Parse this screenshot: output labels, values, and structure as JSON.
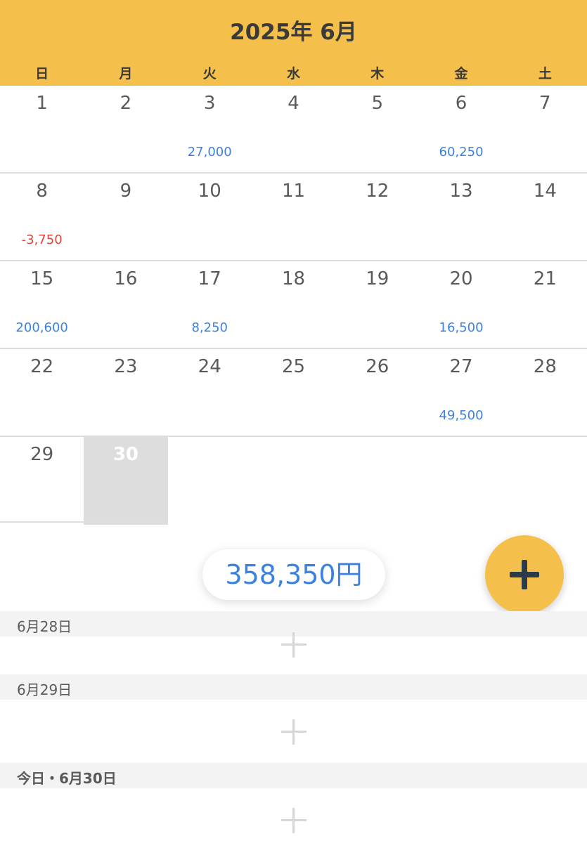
{
  "header": {
    "title": "2025年 6月",
    "weekdays": [
      "日",
      "月",
      "火",
      "水",
      "木",
      "金",
      "土"
    ]
  },
  "calendar": {
    "weeks": [
      [
        {
          "day": "1",
          "amount": ""
        },
        {
          "day": "2",
          "amount": ""
        },
        {
          "day": "3",
          "amount": "27,000"
        },
        {
          "day": "4",
          "amount": ""
        },
        {
          "day": "5",
          "amount": ""
        },
        {
          "day": "6",
          "amount": "60,250"
        },
        {
          "day": "7",
          "amount": ""
        }
      ],
      [
        {
          "day": "8",
          "amount": "-3,750"
        },
        {
          "day": "9",
          "amount": ""
        },
        {
          "day": "10",
          "amount": ""
        },
        {
          "day": "11",
          "amount": ""
        },
        {
          "day": "12",
          "amount": ""
        },
        {
          "day": "13",
          "amount": ""
        },
        {
          "day": "14",
          "amount": ""
        }
      ],
      [
        {
          "day": "15",
          "amount": "200,600"
        },
        {
          "day": "16",
          "amount": ""
        },
        {
          "day": "17",
          "amount": "8,250"
        },
        {
          "day": "18",
          "amount": ""
        },
        {
          "day": "19",
          "amount": ""
        },
        {
          "day": "20",
          "amount": "16,500"
        },
        {
          "day": "21",
          "amount": ""
        }
      ],
      [
        {
          "day": "22",
          "amount": ""
        },
        {
          "day": "23",
          "amount": ""
        },
        {
          "day": "24",
          "amount": ""
        },
        {
          "day": "25",
          "amount": ""
        },
        {
          "day": "26",
          "amount": ""
        },
        {
          "day": "27",
          "amount": "49,500"
        },
        {
          "day": "28",
          "amount": ""
        }
      ],
      [
        {
          "day": "29",
          "amount": ""
        },
        {
          "day": "30",
          "amount": ""
        }
      ]
    ],
    "today": "30"
  },
  "summary": {
    "total": "358,350円"
  },
  "sections": [
    {
      "label": "6月28日"
    },
    {
      "label": "6月29日"
    },
    {
      "label": "今日・6月30日"
    }
  ],
  "colors": {
    "accent": "#f5bf4b",
    "positive": "#3b82e0",
    "negative": "#e0443a",
    "today_bg": "#dddddd"
  },
  "icons": {
    "fab": "plus-icon",
    "add_entry": "plus-icon"
  }
}
